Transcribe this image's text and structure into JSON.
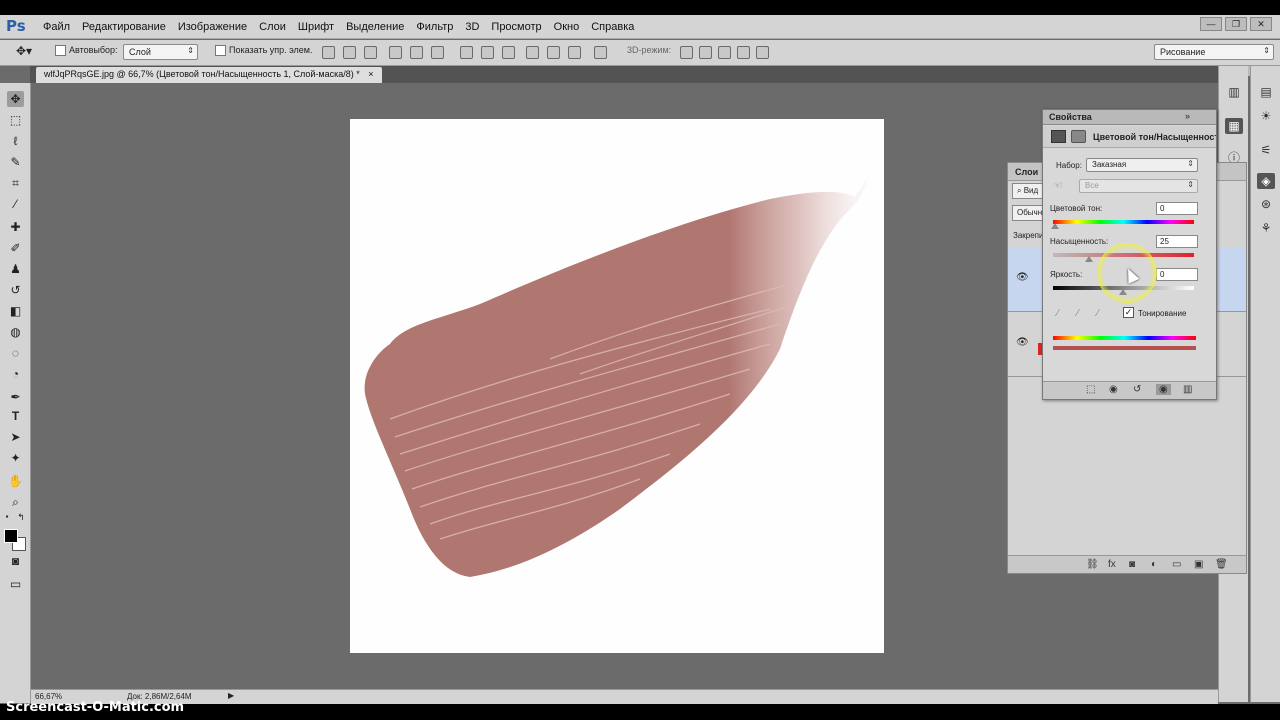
{
  "app": {
    "logo": "Ps",
    "menu": [
      "Файл",
      "Редактирование",
      "Изображение",
      "Слои",
      "Шрифт",
      "Выделение",
      "Фильтр",
      "3D",
      "Просмотр",
      "Окно",
      "Справка"
    ],
    "window_controls": [
      "—",
      "❐",
      "✕"
    ]
  },
  "options": {
    "autoselect_label": "Автовыбор:",
    "autoselect_target": "Слой",
    "show_transform_label": "Показать упр. элем.",
    "mode3d_label": "3D-режим:",
    "workspace": "Рисование"
  },
  "document": {
    "tab_title": "wlfJqPRqsGE.jpg @ 66,7% (Цветовой тон/Насыщенность 1, Слой-маска/8) *",
    "close": "×"
  },
  "statusbar": {
    "zoom": "66,67%",
    "doc_info": "Док: 2,86M/2,64M",
    "arrow": "▶"
  },
  "watermark": "Screencast-O-Matic.com",
  "layers_panel": {
    "tab": "Слои",
    "kind_filter": "Вид",
    "blend_mode": "Обычн",
    "lock_label": "Закрепи",
    "eye": "👁",
    "footer_icons": [
      "⛓",
      "fx",
      "◙",
      "◐",
      "▭",
      "▣",
      "🗑"
    ]
  },
  "properties": {
    "tab": "Свойства",
    "title": "Цветовой тон/Насыщенность",
    "preset_label": "Набор:",
    "preset_value": "Заказная",
    "channel_value": "Все",
    "hue_label": "Цветовой тон:",
    "hue_value": "0",
    "saturation_label": "Насыщенность:",
    "saturation_value": "25",
    "lightness_label": "Яркость:",
    "lightness_value": "0",
    "colorize_label": "Тонирование",
    "colorize_checked": "✓"
  },
  "colors": {
    "stroke": "#b07670",
    "canvas": "#fefefe",
    "ui_panel": "#d4d4d4",
    "workspace": "#6b6b6b"
  }
}
